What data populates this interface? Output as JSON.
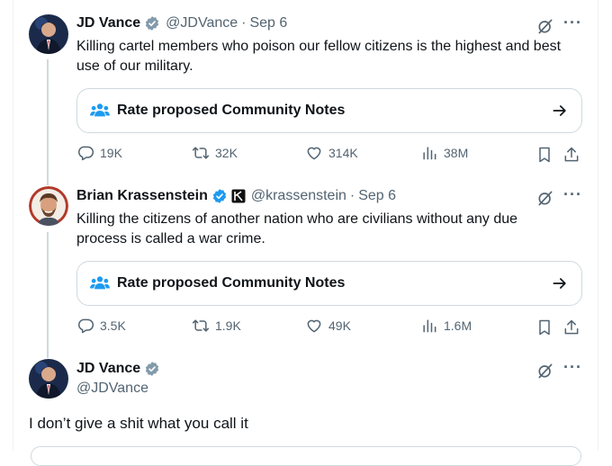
{
  "tweets": [
    {
      "name": "JD Vance",
      "handle": "@JDVance",
      "date": "Sep 6",
      "dot": "·",
      "text": "Killing cartel members who poison our fellow citizens is the highest and best use of our military.",
      "notes_label": "Rate proposed Community Notes",
      "replies": "19K",
      "retweets": "32K",
      "likes": "314K",
      "views": "38M"
    },
    {
      "name": "Brian Krassenstein",
      "handle": "@krassenstein",
      "date": "Sep 6",
      "dot": "·",
      "text": "Killing the citizens of another nation who are civilians without any due process is called a war crime.",
      "notes_label": "Rate proposed Community Notes",
      "replies": "3.5K",
      "retweets": "1.9K",
      "likes": "49K",
      "views": "1.6M"
    },
    {
      "name": "JD Vance",
      "handle": "@JDVance",
      "text": "I don’t give a shit what you call it"
    }
  ],
  "colors": {
    "accent": "#1d9bf0",
    "secondary_text": "#536471",
    "border": "#cfd9de"
  },
  "icons": [
    "verified-badge-icon",
    "grok-icon",
    "more-icon",
    "community-notes-icon",
    "arrow-right-icon",
    "reply-icon",
    "retweet-icon",
    "like-icon",
    "views-icon",
    "bookmark-icon",
    "share-icon"
  ]
}
